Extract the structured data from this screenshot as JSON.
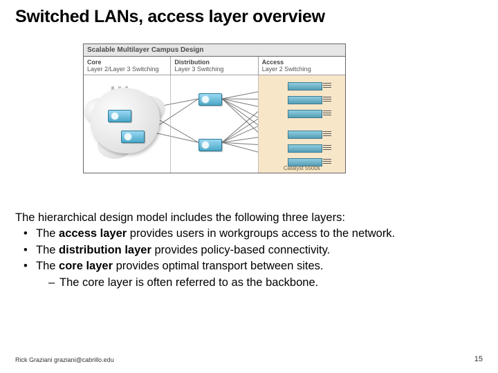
{
  "title": "Switched LANs, access layer overview",
  "diagram": {
    "title": "Scalable Multilayer Campus Design",
    "columns": {
      "core": {
        "name": "Core",
        "desc": "Layer 2/Layer 3 Switching"
      },
      "distribution": {
        "name": "Distribution",
        "desc": "Layer 3 Switching"
      },
      "access": {
        "name": "Access",
        "desc": "Layer 2 Switching"
      }
    },
    "access_caption": "Catalyst 5500s"
  },
  "content": {
    "intro": "The hierarchical design model includes the following three layers:",
    "bullets": [
      {
        "lead": "The ",
        "bold": "access layer",
        "tail": " provides users in workgroups access to the network."
      },
      {
        "lead": "The ",
        "bold": "distribution layer",
        "tail": " provides policy-based connectivity."
      },
      {
        "lead": "The ",
        "bold": "core layer",
        "tail": " provides optimal transport between sites."
      }
    ],
    "sub_bullet": "The core layer is often referred to as the backbone."
  },
  "footer": {
    "author": "Rick Graziani  graziani@cabrillo.edu",
    "page": "15"
  }
}
